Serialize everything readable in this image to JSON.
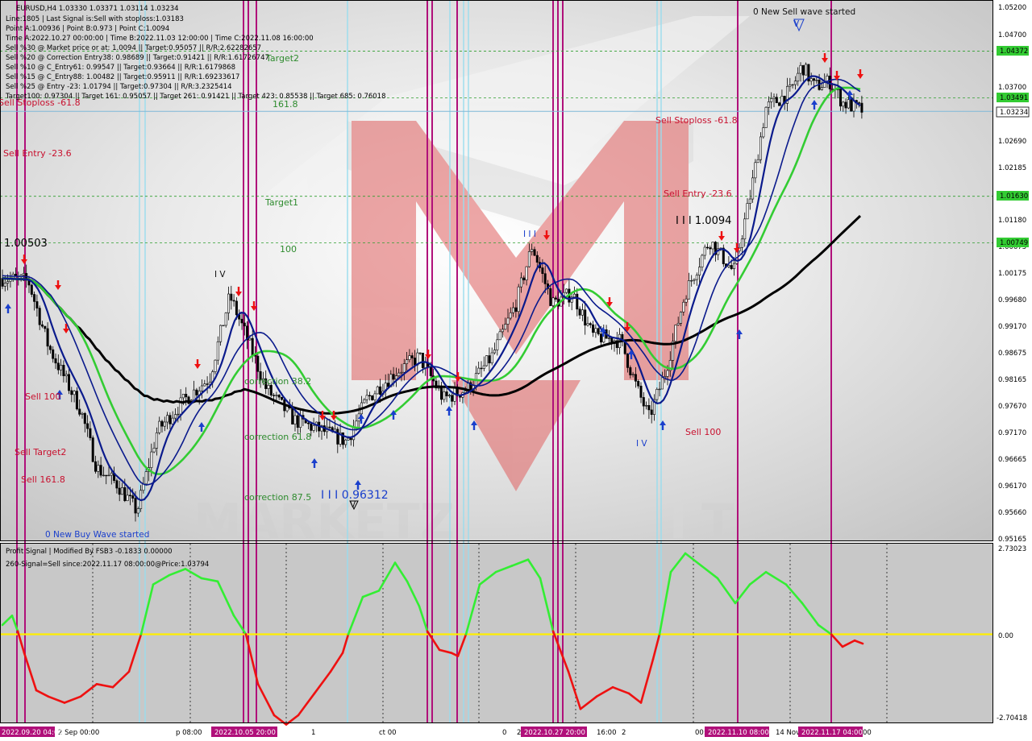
{
  "header_lines": [
    "EURUSD,H4  1.03330 1.03371 1.03114 1.03234",
    "Line:1805  | Last Signal is:Sell with stoploss:1.03183",
    "Point A:1.00936 | Point B:0.973 | Point C:1.0094",
    "Time A:2022.10.27 00:00:00 | Time B:2022.11.03 12:00:00 | Time C:2022.11.08 16:00:00",
    "Sell %30 @ Market price or at: 1.0094 || Target:0.95057 || R/R:2.62282657",
    "Sell %20 @ Correction Entry38: 0.98689 || Target:0.91421 || R/R:1.61726747",
    "Sell %10 @ C_Entry61: 0.99547 || Target:0.93664 || R/R:1.6179868",
    "Sell %15 @ C_Entry88: 1.00482 || Target:0.95911 || R/R:1.69233617",
    "Sell %25 @ Entry -23: 1.01794 || Target:0.97304 || R/R:3.2325414",
    "Target100: 0.97304 || Target 161: 0.95057 || Target 261: 0.91421 || Target 423: 0.85538 || Target 685: 0.76018"
  ],
  "indicator_header": [
    "Profit Signal | Modified By FSB3 -0.1833 0.00000",
    "260-Signal=Sell since:2022.11.17 08:00:00@Price:1.03794"
  ],
  "chart_labels": {
    "new_sell_wave": "0 New Sell wave started",
    "new_buy_wave": "0 New Buy Wave started",
    "target2": "Target2",
    "target1": "Target1",
    "lvl_161": "161.8",
    "lvl_100": "100",
    "sell_stoploss_left": "Sell Stoploss -61.8",
    "sell_stoploss_right": "Sell Stoploss -61.8",
    "sell_entry_left": "Sell Entry -23.6",
    "sell_entry_right": "Sell Entry -23.6",
    "sell_100_left": "Sell 100",
    "sell_100_right": "Sell 100",
    "sell_target2": "Sell Target2",
    "sell_161": "Sell 161.8",
    "correction_38": "correction 38.2",
    "correction_61": "correction 61.8",
    "correction_87": "correction 87.5",
    "price_100503": "1.00503",
    "wave_iii_top": "I I I 1.0094",
    "wave_iii_bottom": "I I I 0.96312",
    "wave_iv_left": "I V",
    "wave_iv_right": "I V",
    "wave_v": "V",
    "wave_iii_small": "I I I",
    "wave_v_bottom": "V"
  },
  "price_axis": [
    "1.05200",
    "1.04700",
    "1.03700",
    "1.02690",
    "1.02185",
    "1.01180",
    "1.00675",
    "1.00175",
    "0.99680",
    "0.99170",
    "0.98675",
    "0.98165",
    "0.97670",
    "0.97170",
    "0.96665",
    "0.96170",
    "0.95660",
    "0.95165"
  ],
  "price_tags": {
    "p1": "1.04372",
    "p2": "1.03491",
    "p3": "1.03234",
    "p4": "1.01630",
    "p5": "1.00749"
  },
  "indicator_axis": [
    "2.73023",
    "0.00",
    "-2.70418"
  ],
  "time_axis": [
    "2 Sep 00:00",
    "p 08:00",
    "1",
    "ct 00",
    "0",
    "2",
    "16:00",
    "2",
    "00:",
    "14 Nov",
    "00"
  ],
  "date_tags": [
    "2022.09.20 04:00",
    "2022.10.05 20:00",
    "2022.10.27 20:00",
    "2022.11.10 08:00",
    "2022.11.17 04:00"
  ],
  "colors": {
    "bull_candle": "#ffffff",
    "bear_candle": "#000000",
    "ma_black": "#000000",
    "ma_green": "#33cc33",
    "ma_navy": "#0a1a8c",
    "vline_magenta": "#b0107a",
    "vline_cyan": "#99ddee",
    "signal_pos": "#33ee33",
    "signal_neg": "#ee1111",
    "zero_line": "#ffee00",
    "watermark": "#e06060"
  },
  "chart_data": {
    "type": "candlestick",
    "title": "EURUSD,H4",
    "ylim": [
      0.9516,
      1.052
    ],
    "x": [
      "2022.09.02",
      "2022.09.20",
      "2022.10.05",
      "2022.10.19",
      "2022.10.27",
      "2022.11.03",
      "2022.11.10",
      "2022.11.17"
    ],
    "series": [
      {
        "name": "close",
        "values": [
          1.005,
          0.9566,
          0.9876,
          0.973,
          1.0094,
          0.973,
          1.016,
          1.0323
        ]
      }
    ],
    "levels": [
      1.04372,
      1.03491,
      1.03234,
      1.0163,
      1.00749
    ],
    "indicator": {
      "title": "Profit Signal | Modified By FSB3",
      "ylim": [
        -2.70418,
        2.73023
      ]
    }
  }
}
